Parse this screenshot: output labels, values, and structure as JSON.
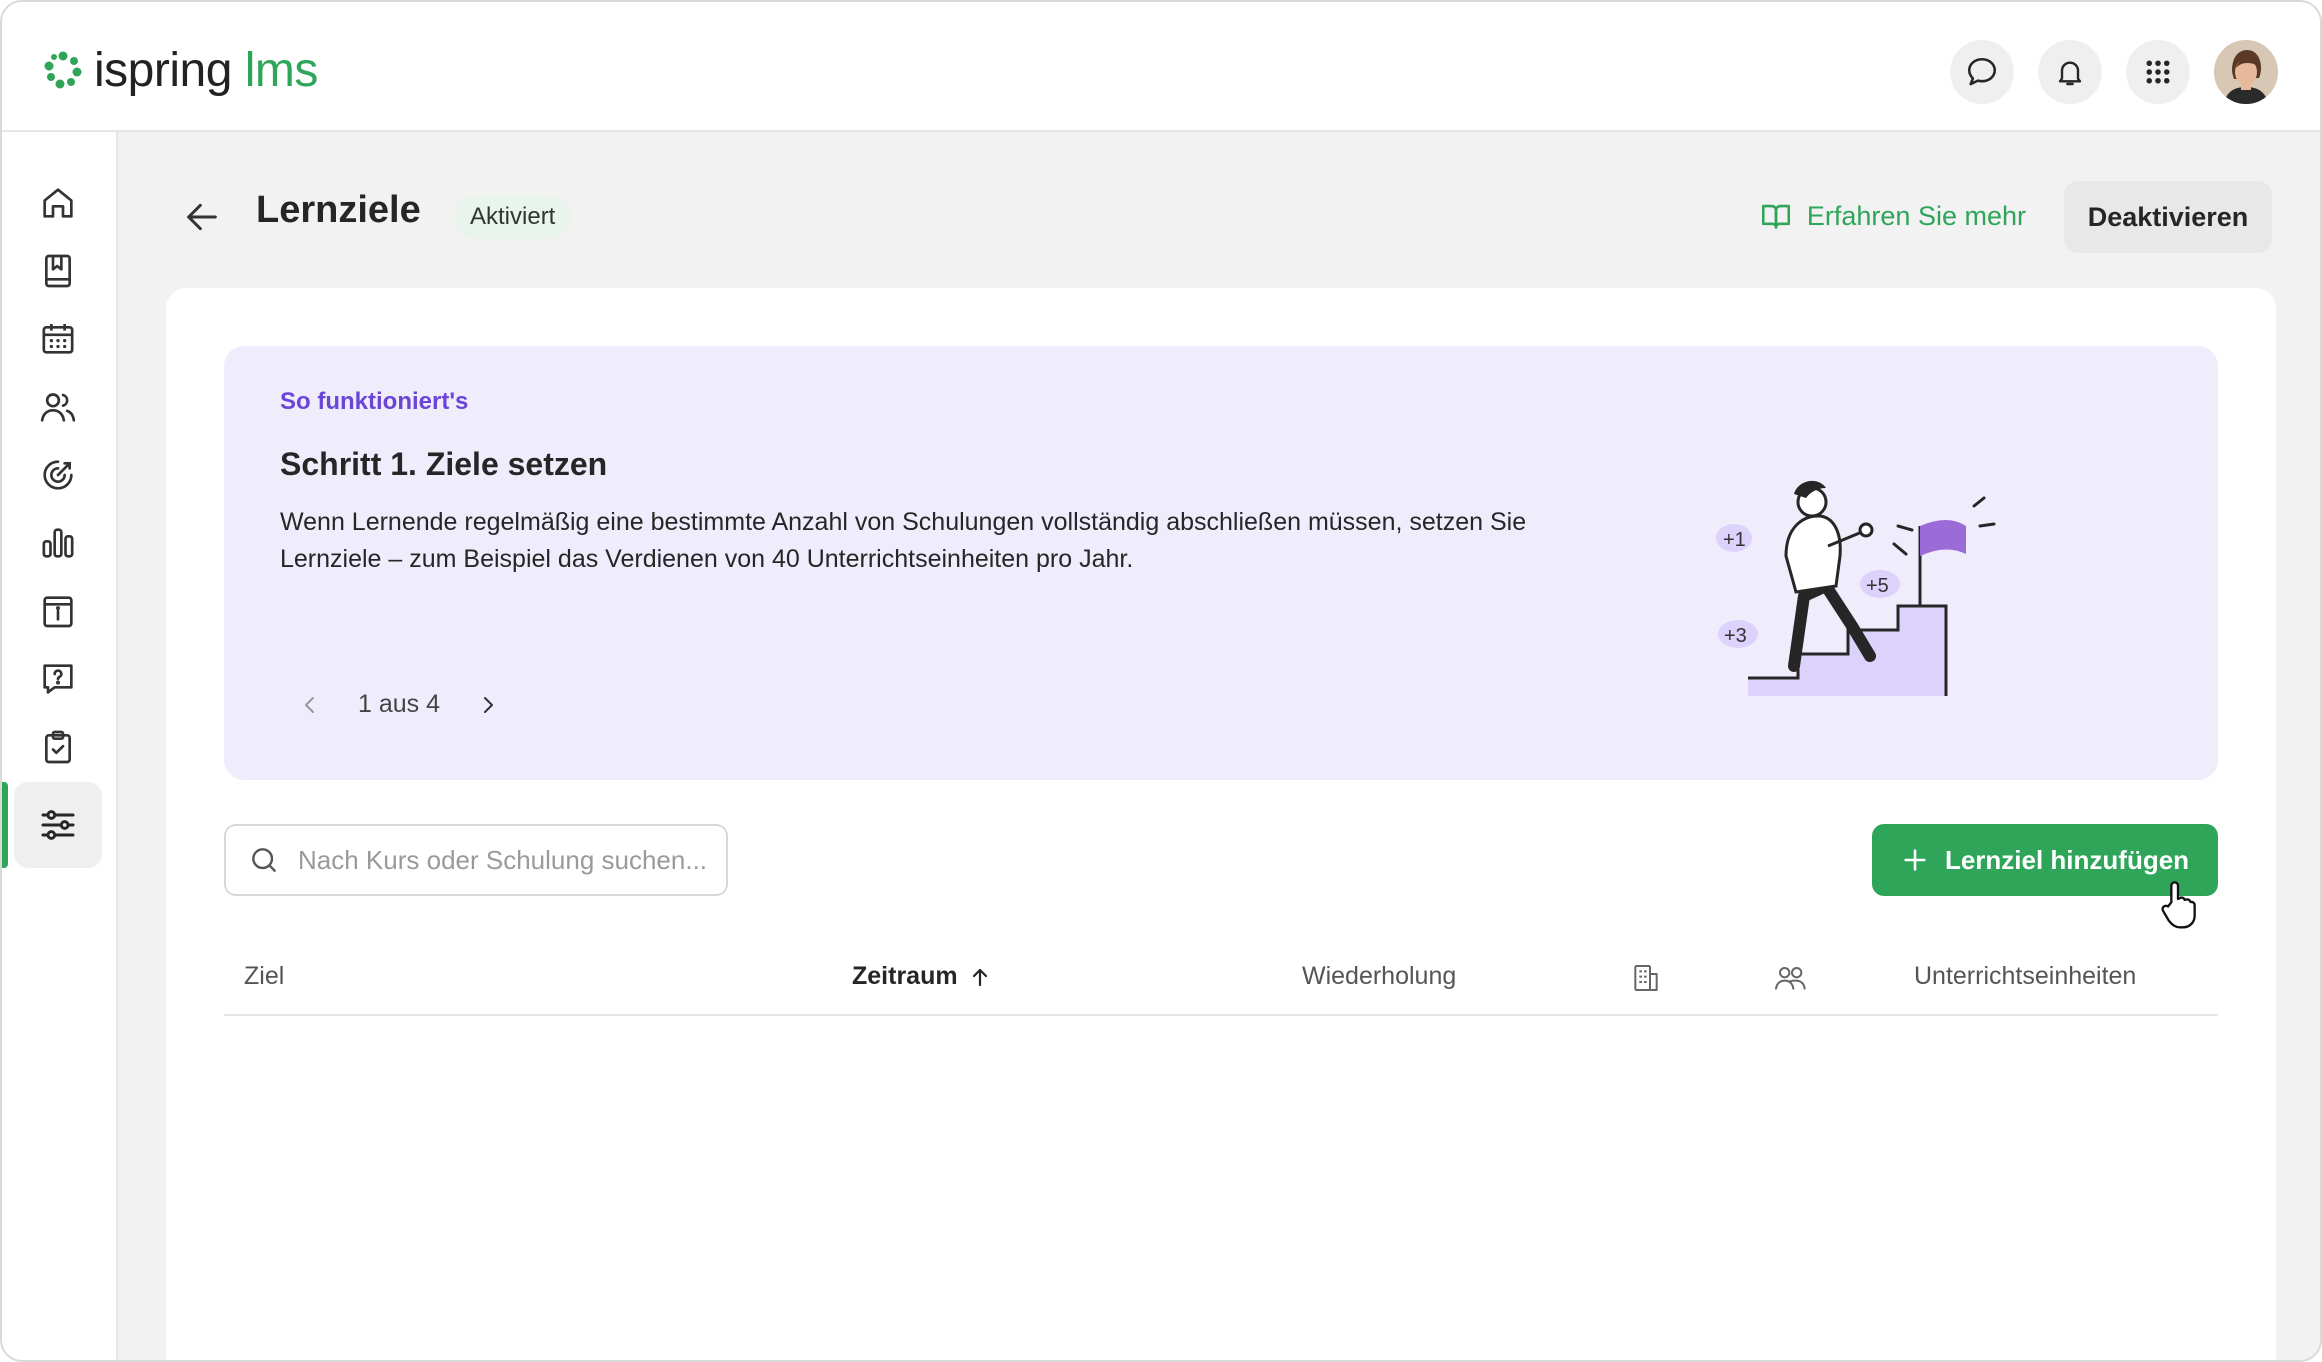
{
  "brand": {
    "name_primary": "ispring",
    "name_secondary": "lms",
    "accent_color": "#2fa55a",
    "purple_color": "#6b45d6"
  },
  "header_icons": [
    "chat-icon",
    "bell-icon",
    "apps-grid-icon",
    "user-avatar"
  ],
  "sidebar": {
    "items": [
      {
        "name": "home-icon",
        "active": false
      },
      {
        "name": "book-icon",
        "active": false
      },
      {
        "name": "calendar-icon",
        "active": false
      },
      {
        "name": "users-icon",
        "active": false
      },
      {
        "name": "target-icon",
        "active": false
      },
      {
        "name": "chart-icon",
        "active": false
      },
      {
        "name": "info-board-icon",
        "active": false
      },
      {
        "name": "help-icon",
        "active": false
      },
      {
        "name": "clipboard-check-icon",
        "active": false
      },
      {
        "name": "support-agent-icon",
        "active": false
      },
      {
        "name": "settings-sliders-icon",
        "active": true
      }
    ]
  },
  "page": {
    "title": "Lernziele",
    "status": "Aktiviert",
    "learn_more": "Erfahren Sie mehr",
    "deactivate": "Deaktivieren"
  },
  "info": {
    "eyebrow": "So funktioniert's",
    "heading": "Schritt 1. Ziele setzen",
    "text": "Wenn Lernende regelmäßig eine bestimmte Anzahl von Schulungen vollständig abschließen müssen, setzen Sie Lernziele – zum Beispiel das Verdienen von 40 Unterrichtseinheiten pro Jahr.",
    "pager": "1 aus 4",
    "badges": [
      "+1",
      "+5",
      "+3"
    ]
  },
  "search": {
    "placeholder": "Nach Kurs oder Schulung suchen...",
    "value": ""
  },
  "add_button": "Lernziel hinzufügen",
  "table": {
    "columns": [
      "Ziel",
      "Zeitraum",
      "Wiederholung",
      "",
      "",
      "Unterrichtseinheiten"
    ],
    "sorted_column": "Zeitraum",
    "sort_direction": "ascending",
    "icon_columns": [
      "building-icon",
      "group-icon"
    ],
    "rows": []
  }
}
